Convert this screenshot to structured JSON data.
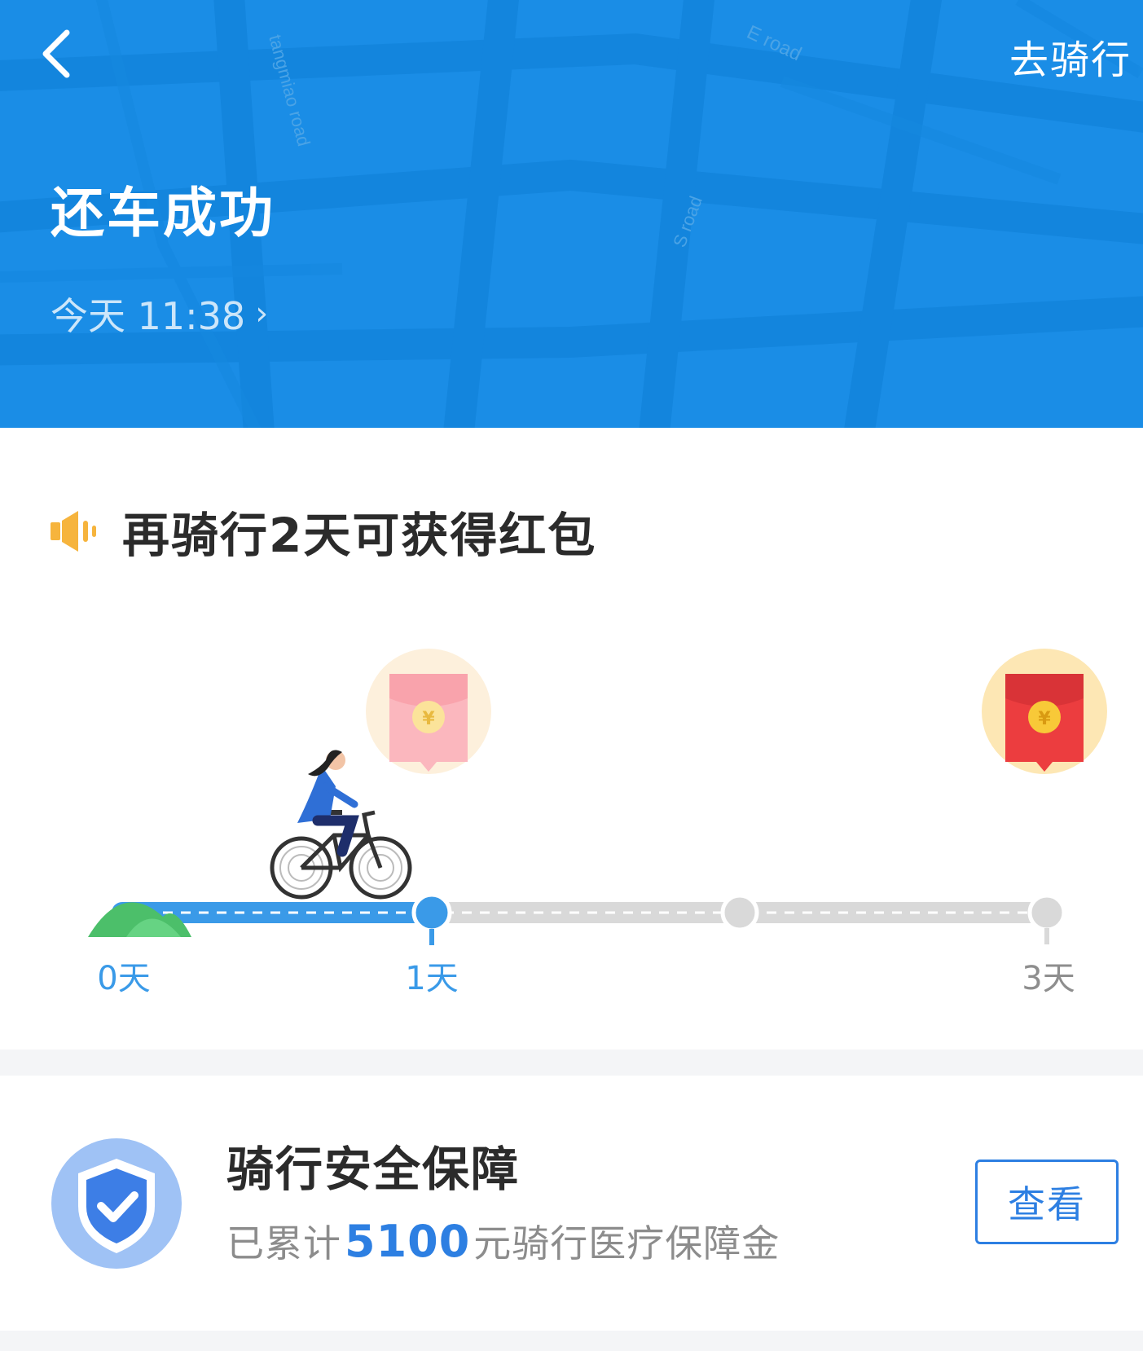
{
  "header": {
    "back_icon": "chevron-left-icon",
    "go_ride_label": "去骑行",
    "title": "还车成功",
    "time_text": "今天 11:38",
    "time_chevron": "›",
    "map_labels": [
      "tangmiao road",
      "E road",
      "S road"
    ],
    "bg_color": "#1a8de6"
  },
  "reward": {
    "speaker_icon": "speaker-icon",
    "message": "再骑行2天可获得红包",
    "progress": {
      "current_day": 1,
      "days_labels": [
        "0天",
        "1天",
        "3天"
      ],
      "envelope_icon": "red-envelope-icon",
      "cyclist_icon": "cyclist-illustration",
      "active_color": "#3a9ae8",
      "inactive_color": "#d9d9d9"
    }
  },
  "insurance": {
    "shield_icon": "shield-check-icon",
    "title": "骑行安全保障",
    "sub_prefix": "已累计",
    "amount": "5100",
    "sub_suffix": "元骑行医疗保障金",
    "view_button": "查看"
  }
}
